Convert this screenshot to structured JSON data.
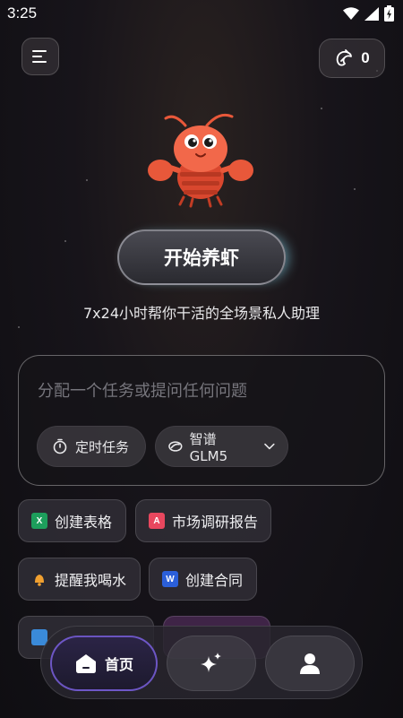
{
  "status_bar": {
    "time": "3:25"
  },
  "header": {
    "credits": "0"
  },
  "hero": {
    "start_label": "开始养虾",
    "tagline": "7x24小时帮你干活的全场景私人助理"
  },
  "input": {
    "placeholder": "分配一个任务或提问任何问题",
    "schedule_label": "定时任务",
    "model_label": "智谱 GLM5"
  },
  "quick_actions": [
    {
      "label": "创建表格",
      "icon": "excel-icon"
    },
    {
      "label": "市场调研报告",
      "icon": "pdf-icon"
    },
    {
      "label": "提醒我喝水",
      "icon": "bell-icon"
    },
    {
      "label": "创建合同",
      "icon": "word-icon"
    }
  ],
  "bottom_nav": {
    "home_label": "首页"
  },
  "colors": {
    "accent_purple": "#8c6eff",
    "glow_cyan": "#8ce6ff",
    "excel_green": "#1d9e5c",
    "pdf_red": "#e8475e",
    "word_blue": "#2b5fd9"
  }
}
